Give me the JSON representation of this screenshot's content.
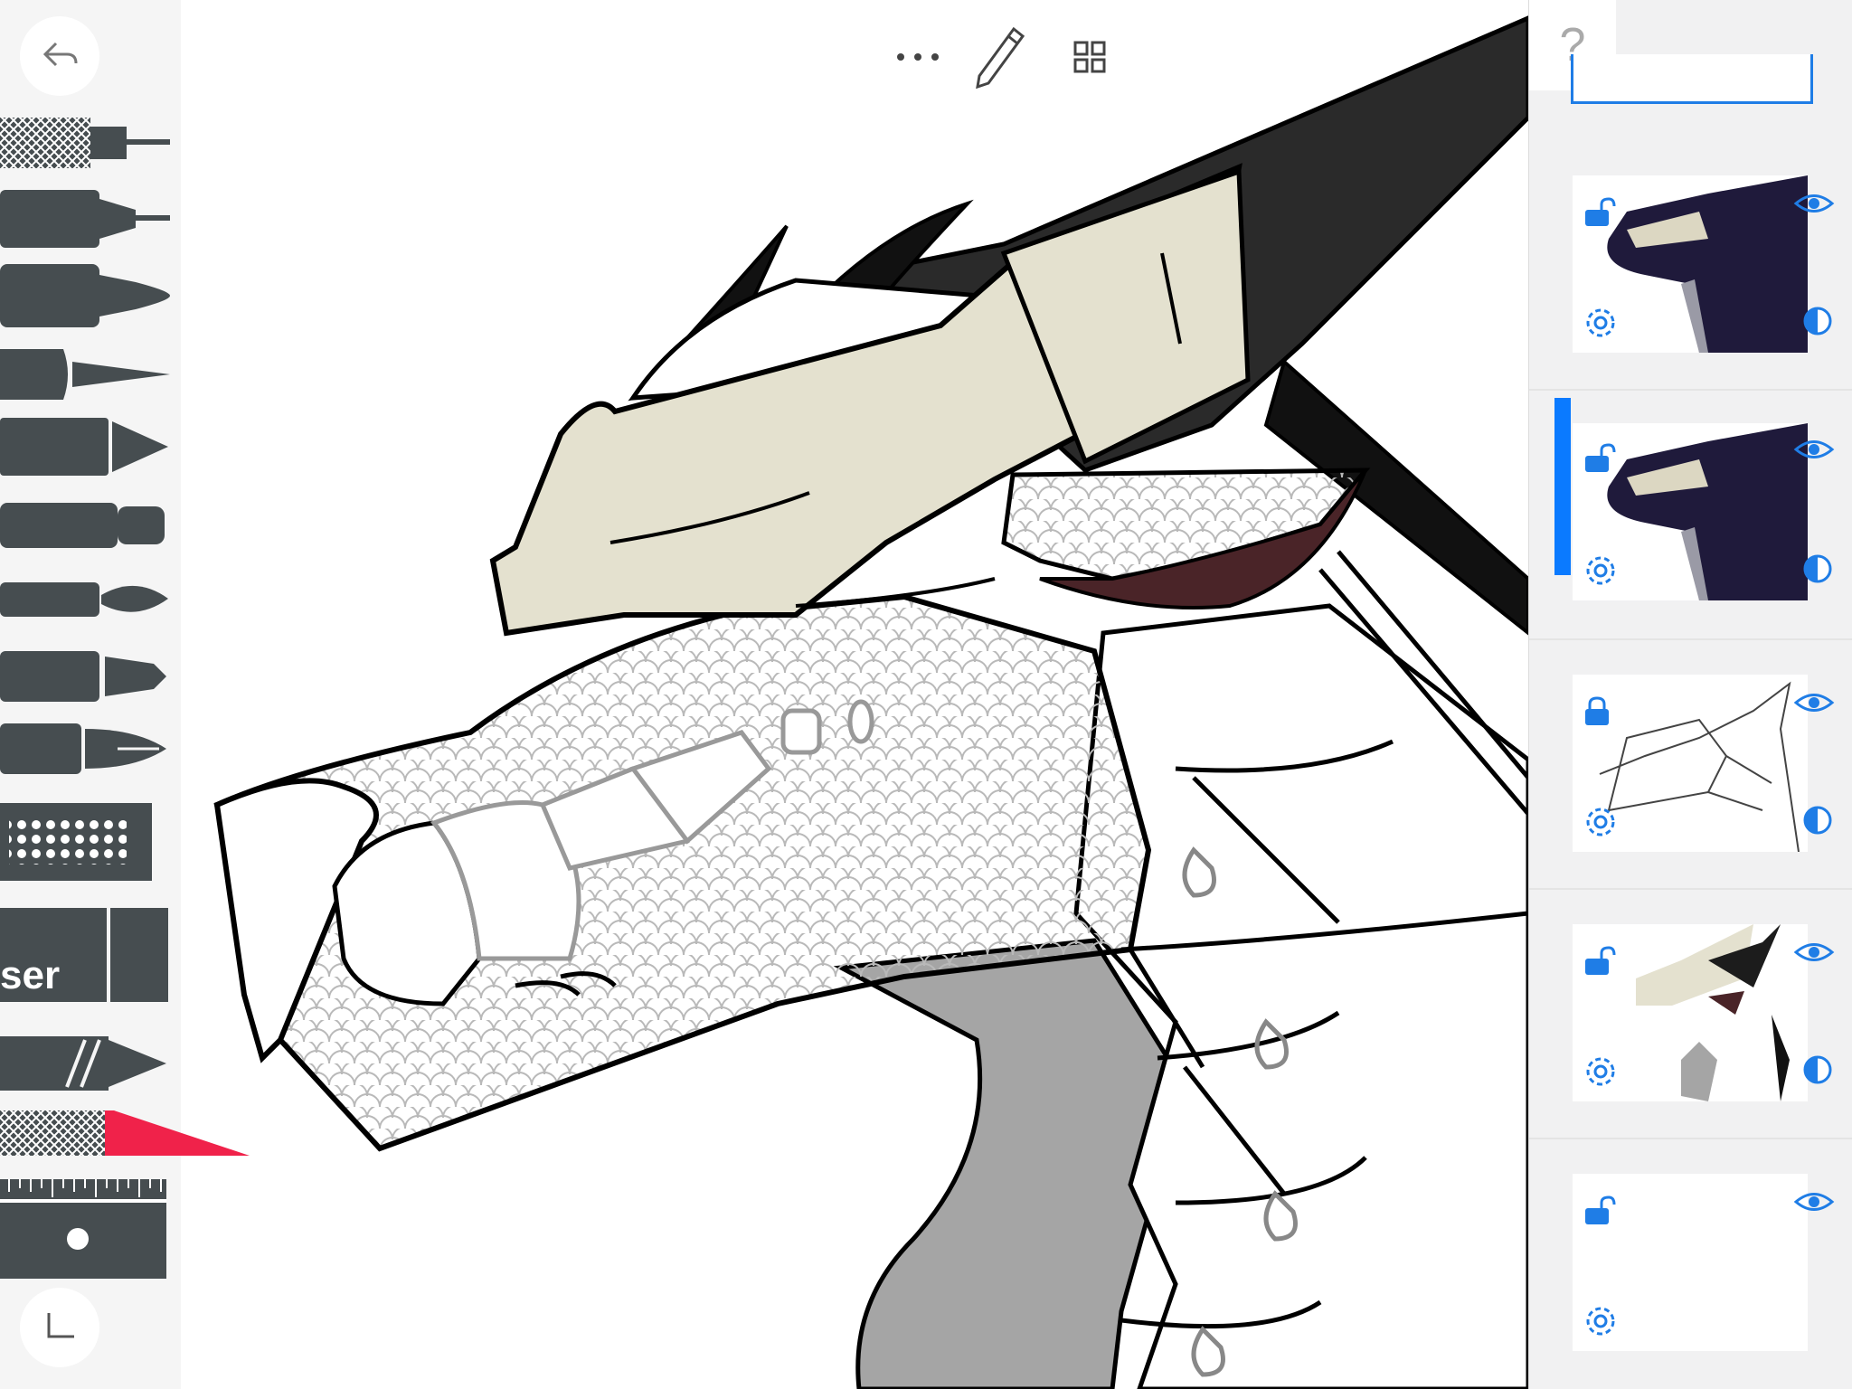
{
  "app": {
    "accent_color": "#0a7aff",
    "canvas_background": "#ffffff"
  },
  "tool_palette": {
    "back_button_icon": "undo-arrow-icon",
    "corner_button_icon": "corner-angle-icon",
    "eraser_label": "ser",
    "tools": [
      {
        "name": "technical-pen",
        "icon": "technical-pen-icon"
      },
      {
        "name": "fine-liner",
        "icon": "fine-liner-icon"
      },
      {
        "name": "marker",
        "icon": "marker-icon"
      },
      {
        "name": "pencil-taper",
        "icon": "taper-pen-icon"
      },
      {
        "name": "chisel-marker",
        "icon": "chisel-marker-icon"
      },
      {
        "name": "round-brush",
        "icon": "round-brush-icon"
      },
      {
        "name": "paint-brush",
        "icon": "paint-brush-icon"
      },
      {
        "name": "bullet-marker",
        "icon": "bullet-marker-icon"
      },
      {
        "name": "fountain-pen",
        "icon": "fountain-pen-icon"
      },
      {
        "name": "halftone-stamp",
        "icon": "halftone-stamp-icon"
      },
      {
        "name": "eraser",
        "icon": "eraser-icon"
      },
      {
        "name": "smudge",
        "icon": "smudge-icon"
      },
      {
        "name": "x-acto-knife",
        "icon": "x-acto-knife-icon",
        "selected": true,
        "highlight_color": "#f0224a"
      },
      {
        "name": "ruler",
        "icon": "ruler-icon"
      }
    ]
  },
  "top_toolbar": {
    "more_icon": "more-dots-icon",
    "pencil_icon": "pencil-icon",
    "grid_icon": "grid-view-icon"
  },
  "layers_panel": {
    "help_label": "?",
    "layers": [
      {
        "id": "layer-colored-1",
        "locked": false,
        "visible": true,
        "selected": false,
        "thumbnail": "colored-dragon"
      },
      {
        "id": "layer-colored-2",
        "locked": false,
        "visible": true,
        "selected": true,
        "thumbnail": "colored-dragon"
      },
      {
        "id": "layer-lineart",
        "locked": true,
        "visible": true,
        "selected": false,
        "thumbnail": "lineart-dragon"
      },
      {
        "id": "layer-flats",
        "locked": false,
        "visible": true,
        "selected": false,
        "thumbnail": "flat-colors"
      },
      {
        "id": "layer-blank",
        "locked": false,
        "visible": true,
        "selected": false,
        "thumbnail": "blank"
      }
    ]
  }
}
